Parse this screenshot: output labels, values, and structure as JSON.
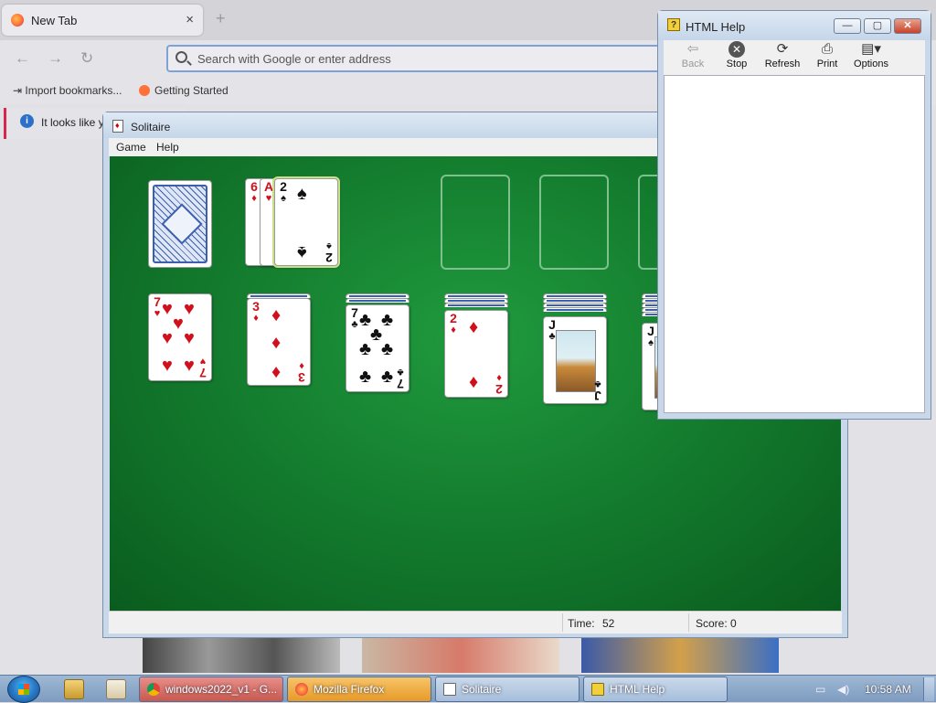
{
  "firefox": {
    "tab_title": "New Tab",
    "tab_close": "×",
    "new_tab": "+",
    "back": "←",
    "forward": "→",
    "reload": "↻",
    "url_placeholder": "Search with Google or enter address",
    "bookmarks": [
      "Import bookmarks...",
      "Getting Started"
    ],
    "info_bar": "It looks like y"
  },
  "solitaire": {
    "title": "Solitaire",
    "menu": [
      "Game",
      "Help"
    ],
    "time_label": "Time:",
    "time_value": "52",
    "score_label": "Score:",
    "score_value": "0",
    "stock_waste": [
      "6♦",
      "A♥",
      "2♠"
    ],
    "tableau": [
      {
        "rank": "7",
        "suit": "♥",
        "color": "red"
      },
      {
        "rank": "3",
        "suit": "♦",
        "color": "red"
      },
      {
        "rank": "7",
        "suit": "♣",
        "color": "black"
      },
      {
        "rank": "2",
        "suit": "♦",
        "color": "red"
      },
      {
        "rank": "J",
        "suit": "♣",
        "color": "black"
      },
      {
        "rank": "J",
        "suit": "♠",
        "color": "black"
      }
    ]
  },
  "help": {
    "title": "HTML Help",
    "toolbar": [
      "Back",
      "Stop",
      "Refresh",
      "Print",
      "Options"
    ],
    "minimize": "—",
    "maximize": "▢",
    "close": "✕"
  },
  "taskbar": {
    "tasks": [
      "windows2022_v1 - G...",
      "Mozilla Firefox",
      "Solitaire",
      "HTML Help"
    ],
    "clock": "10:58 AM"
  },
  "colors": {
    "felt": "#12782c",
    "red_suit": "#d0101a",
    "card_back": "#3c5fae"
  }
}
